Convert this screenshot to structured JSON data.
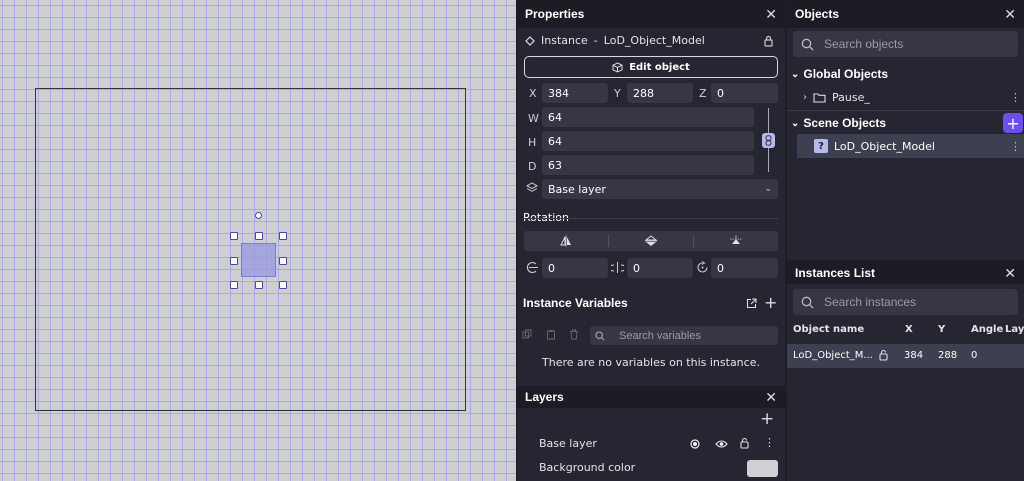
{
  "properties": {
    "title": "Properties",
    "instance_label": "Instance",
    "separator": "-",
    "object_name": "LoD_Object_Model",
    "edit_button": "Edit object",
    "x_label": "X",
    "x": "384",
    "y_label": "Y",
    "y": "288",
    "z_label": "Z",
    "z": "0",
    "w_label": "W",
    "w": "64",
    "h_label": "H",
    "h": "64",
    "d_label": "D",
    "d": "63",
    "layer": "Base layer",
    "rotation_title": "Rotation",
    "rot_x": "0",
    "rot_y": "0",
    "rot_z": "0"
  },
  "instance_variables": {
    "title": "Instance Variables",
    "search_placeholder": "Search variables",
    "empty_text": "There are no variables on this instance."
  },
  "layers": {
    "title": "Layers",
    "base_layer": "Base layer",
    "background_color_label": "Background color",
    "background_color": "#d0d0d4"
  },
  "objects": {
    "title": "Objects",
    "search_placeholder": "Search objects",
    "global_group": "Global Objects",
    "global_items": [
      "Pause_"
    ],
    "scene_group": "Scene Objects",
    "scene_items": [
      "LoD_Object_Model"
    ]
  },
  "instances_list": {
    "title": "Instances List",
    "search_placeholder": "Search instances",
    "columns": [
      "Object name",
      "X",
      "Y",
      "Angle",
      "Laye"
    ],
    "rows": [
      {
        "name": "LoD_Object_M...",
        "x": "384",
        "y": "288",
        "angle": "0"
      }
    ]
  },
  "colors": {
    "accent": "#6c4fe8",
    "panel_bg": "#262632",
    "field_bg": "#363644",
    "canvas_bg": "#cfcfd3"
  }
}
